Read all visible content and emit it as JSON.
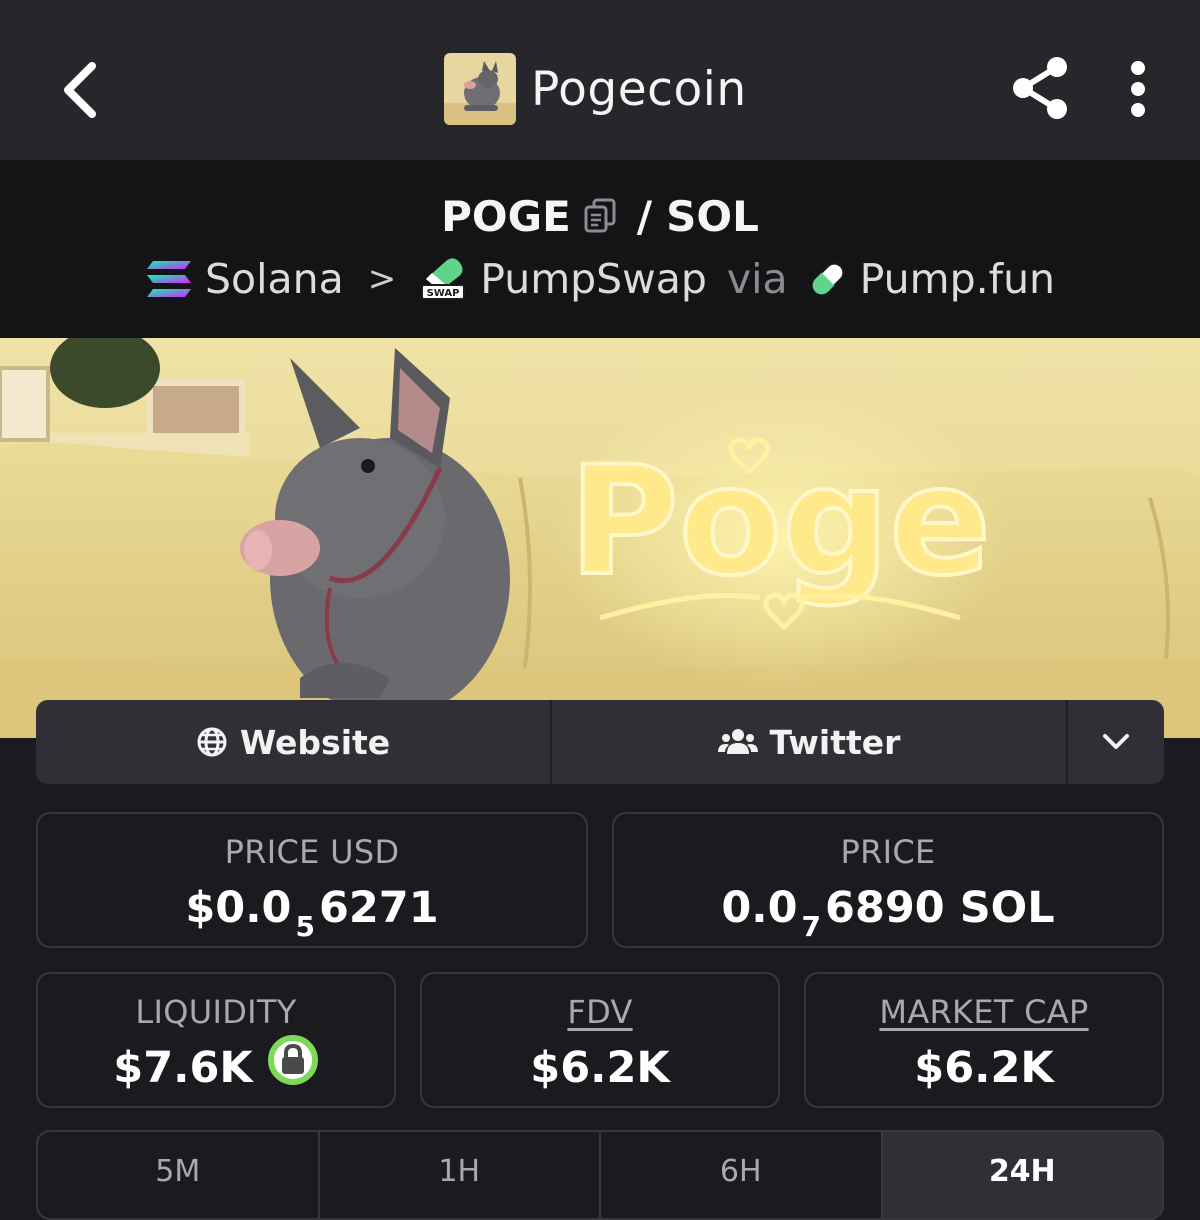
{
  "header": {
    "title": "Pogecoin",
    "back_icon": "chevron-left-icon",
    "share_icon": "share-icon",
    "more_icon": "more-vertical-icon"
  },
  "pair": {
    "base": "POGE",
    "slash": "/",
    "quote": "SOL",
    "chain": "Solana",
    "separator": ">",
    "dex": "PumpSwap",
    "dex_badge": "SWAP",
    "via": "via",
    "launchpad": "Pump.fun"
  },
  "links": {
    "website": "Website",
    "twitter": "Twitter"
  },
  "stats": {
    "price_usd": {
      "label": "PRICE USD",
      "prefix": "$0.0",
      "zeros": "5",
      "digits": "6271"
    },
    "price": {
      "label": "PRICE",
      "prefix": "0.0",
      "zeros": "7",
      "digits": "6890",
      "unit": "SOL"
    },
    "liquidity": {
      "label": "LIQUIDITY",
      "value": "$7.6K"
    },
    "fdv": {
      "label": "FDV",
      "value": "$6.2K"
    },
    "market_cap": {
      "label": "MARKET CAP",
      "value": "$6.2K"
    }
  },
  "banner": {
    "text": "Poge"
  },
  "timeframes": [
    "5M",
    "1H",
    "6H",
    "24H"
  ],
  "active_timeframe": "24H",
  "colors": {
    "background": "#1b1b1f",
    "topbar": "#26262b",
    "lock_green": "#7ed957"
  }
}
